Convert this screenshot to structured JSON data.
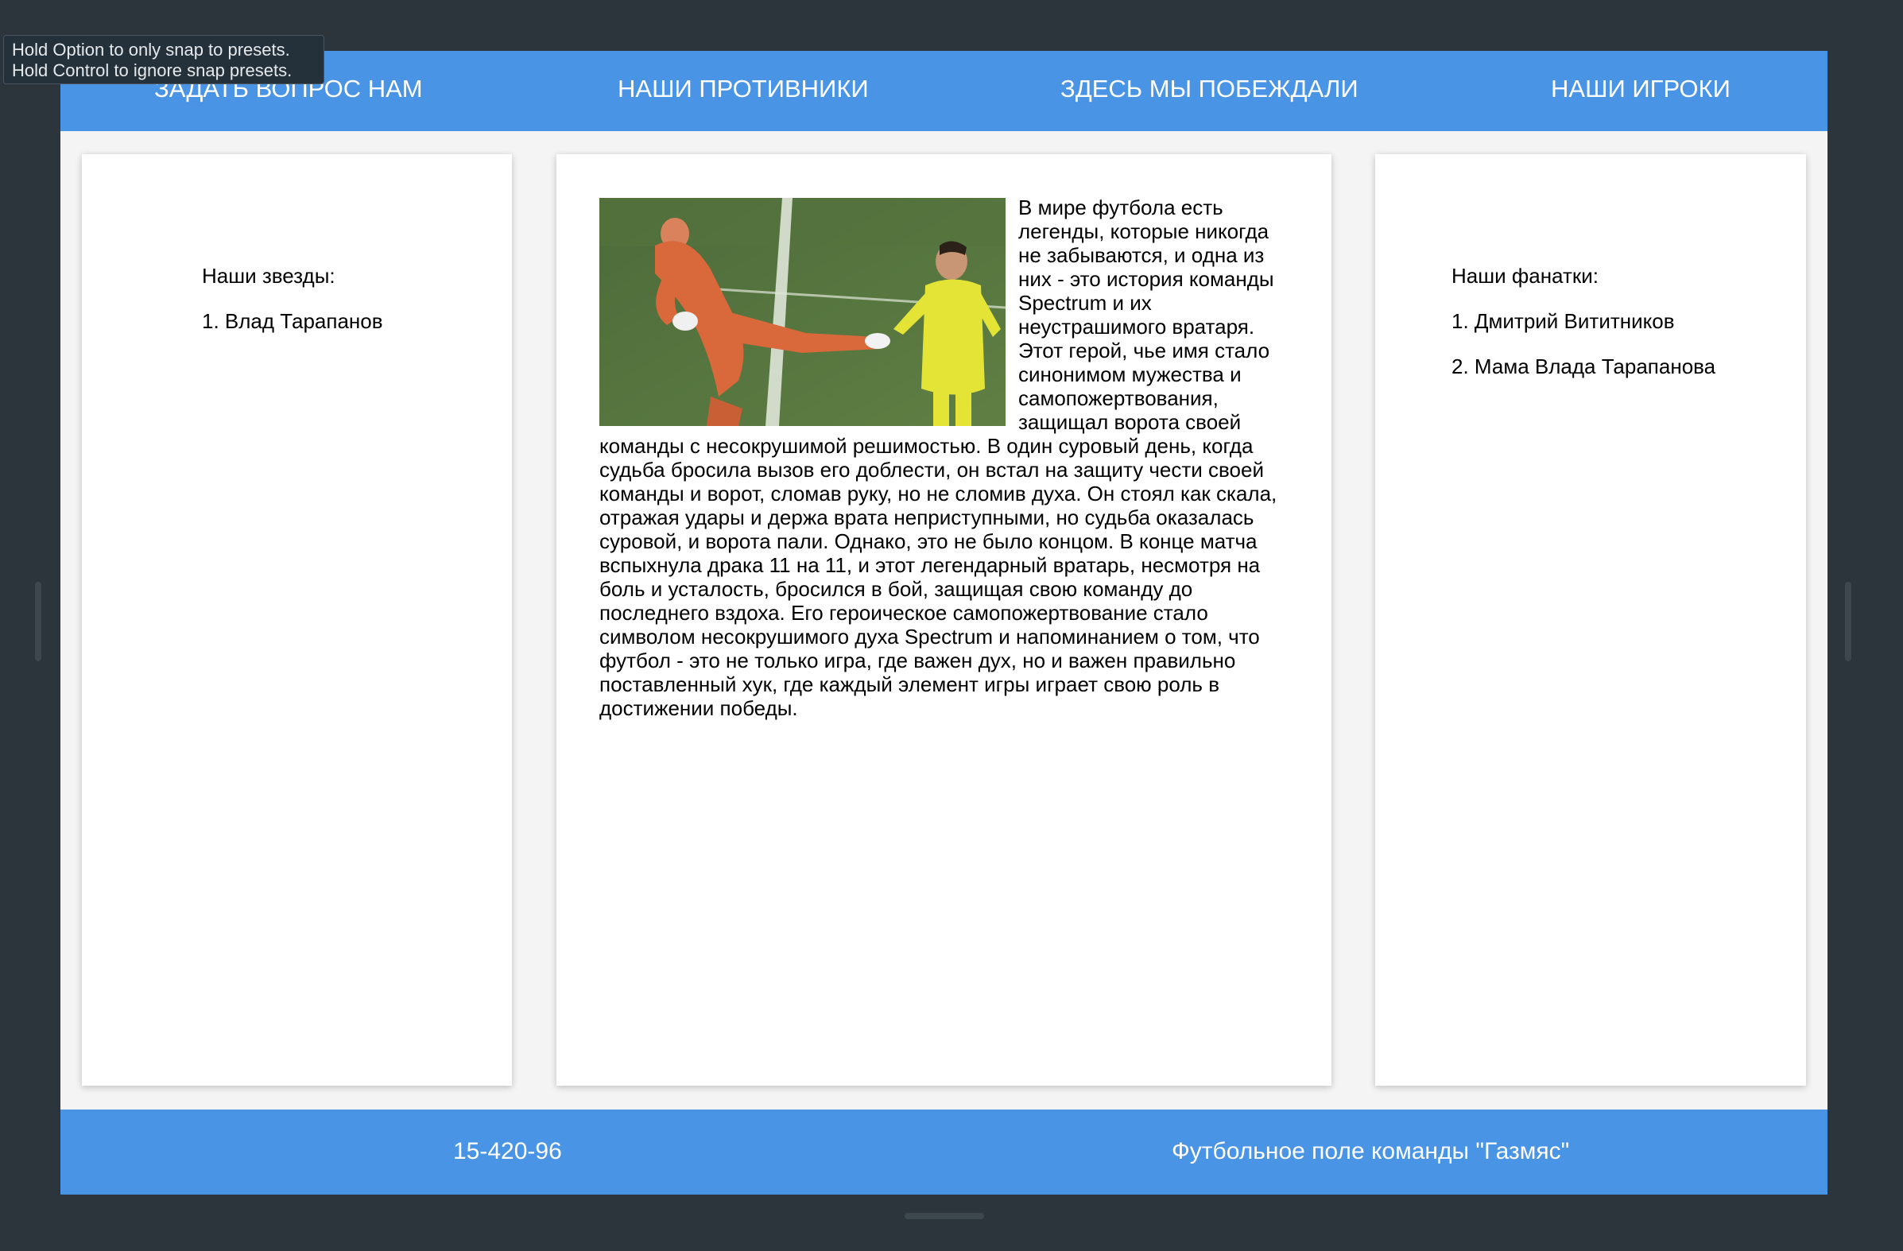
{
  "tooltip": {
    "line1": "Hold Option to only snap to presets.",
    "line2": "Hold Control to ignore snap presets."
  },
  "nav": {
    "items": [
      {
        "label": "ЗАДАТЬ ВОПРОС НАМ"
      },
      {
        "label": "НАШИ ПРОТИВНИКИ"
      },
      {
        "label": "ЗДЕСЬ МЫ ПОБЕЖДАЛИ"
      },
      {
        "label": "НАШИ ИГРОКИ"
      }
    ]
  },
  "left": {
    "heading": "Наши звезды:",
    "items": [
      "1. Влад Тарапанов"
    ]
  },
  "center": {
    "image_desc": "goalkeeper-kick-photo",
    "text": "В мире футбола есть легенды, которые никогда не забываются, и одна из них - это история команды Spectrum и их неустрашимого вратаря. Этот герой, чье имя стало синонимом мужества и самопожертвования, защищал ворота своей команды с несокрушимой решимостью. В один суровый день, когда судьба бросила вызов его доблести, он встал на защиту чести своей команды и ворот, сломав руку, но не сломив духа. Он стоял как скала, отражая удары и держа врата неприступными, но судьба оказалась суровой, и ворота пали. Однако, это не было концом. В конце матча вспыхнула драка 11 на 11, и этот легендарный вратарь, несмотря на боль и усталость, бросился в бой, защищая свою команду до последнего вздоха. Его героическое самопожертвование стало символом несокрушимого духа Spectrum и напоминанием о том, что футбол - это не только игра, где важен дух, но и важен правильно поставленный хук, где каждый элемент игры играет свою роль в достижении победы."
  },
  "right": {
    "heading": "Наши фанатки:",
    "items": [
      "1. Дмитрий Вититников",
      "2. Мама Влада Тарапанова"
    ]
  },
  "footer": {
    "phone": "15-420-96",
    "place": "Футбольное поле команды \"Газмяс\""
  },
  "colors": {
    "accent": "#4a94e6",
    "background": "#2b353b",
    "page": "#f4f4f4"
  }
}
